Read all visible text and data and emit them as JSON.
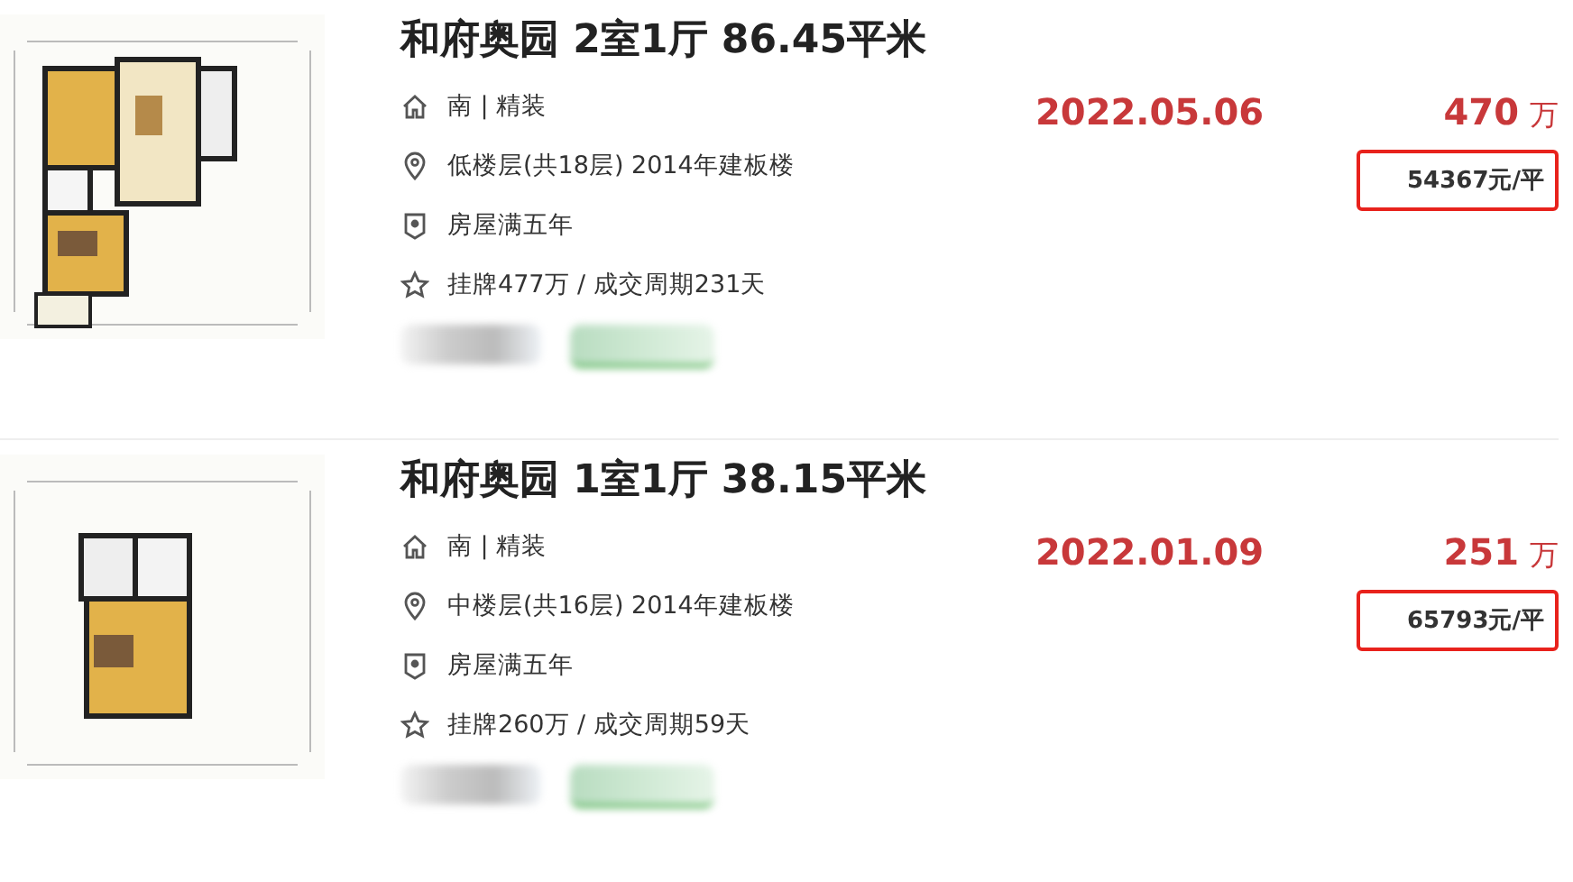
{
  "listings": [
    {
      "title": "和府奥园 2室1厅 86.45平米",
      "orientation": "南 | 精装",
      "floor": "低楼层(共18层) 2014年建板楼",
      "tag": "房屋满五年",
      "listing": "挂牌477万 / 成交周期231天",
      "date": "2022.05.06",
      "price": "470",
      "price_unit": "万",
      "unit_price": "54367元/平"
    },
    {
      "title": "和府奥园 1室1厅 38.15平米",
      "orientation": "南 | 精装",
      "floor": "中楼层(共16层) 2014年建板楼",
      "tag": "房屋满五年",
      "listing": "挂牌260万 / 成交周期59天",
      "date": "2022.01.09",
      "price": "251",
      "price_unit": "万",
      "unit_price": "65793元/平"
    }
  ]
}
